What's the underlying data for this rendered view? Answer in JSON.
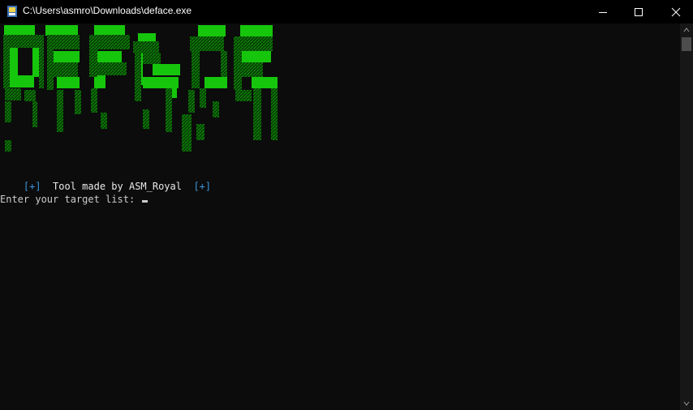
{
  "window": {
    "title": "C:\\Users\\asmro\\Downloads\\deface.exe"
  },
  "icons": {
    "app": "console-app-icon",
    "minimize": "minimize-icon",
    "maximize": "maximize-icon",
    "close": "close-icon",
    "scroll_up": "scroll-up-arrow-icon",
    "scroll_down": "scroll-down-arrow-icon"
  },
  "banner": {
    "logo": "DEFACE",
    "colors": {
      "bright": "#16c60c",
      "dark": "#0a6e06"
    }
  },
  "console": {
    "credit_open": "[+]",
    "credit_text": "  Tool made by ASM_Royal  ",
    "credit_close": "[+]",
    "prompt": "Enter your target list: "
  },
  "colors": {
    "background": "#0c0c0c",
    "text": "#cccccc",
    "accent_blue": "#3a96dd"
  }
}
